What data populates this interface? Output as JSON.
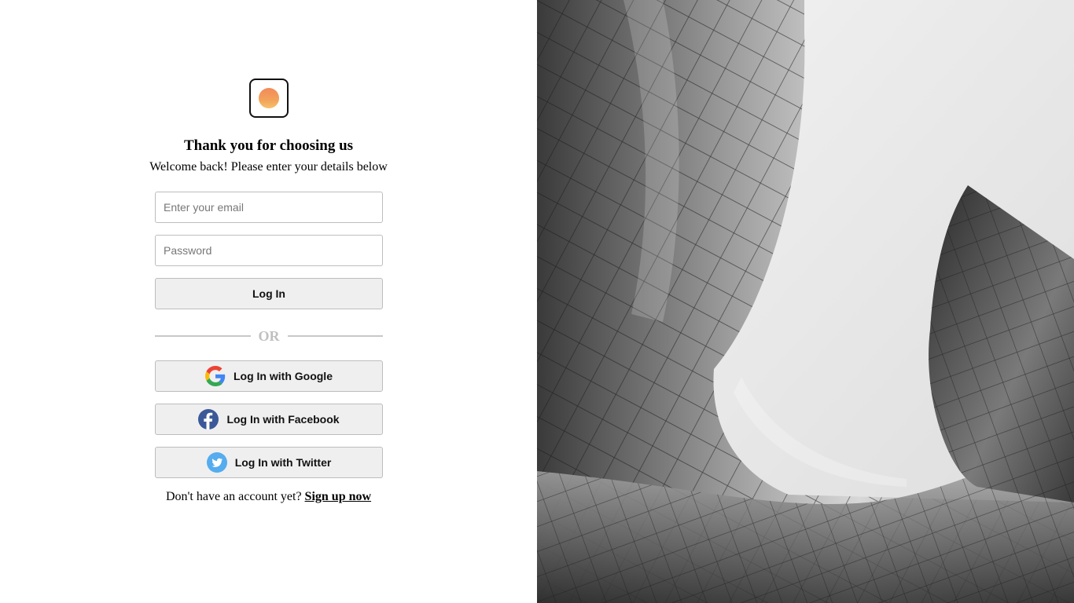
{
  "header": {
    "title": "Thank you for choosing us",
    "subtitle": "Welcome back! Please enter your details below"
  },
  "form": {
    "email_placeholder": "Enter your email",
    "password_placeholder": "Password",
    "email_value": "",
    "password_value": "",
    "login_label": "Log In"
  },
  "divider": {
    "label": "OR"
  },
  "social": {
    "google_label": "Log In with Google",
    "facebook_label": "Log In with Facebook",
    "twitter_label": "Log In with Twitter",
    "google_icon": "google-icon",
    "facebook_icon": "facebook-icon",
    "twitter_icon": "twitter-icon"
  },
  "footer": {
    "prompt": "Don't have an account yet?",
    "signup_label": "Sign up now"
  },
  "colors": {
    "logo_accent": "#f2955a",
    "facebook": "#3b5998",
    "twitter": "#55acee",
    "button_bg": "#efefef"
  },
  "hero_image": {
    "icon": "architecture-photo"
  }
}
